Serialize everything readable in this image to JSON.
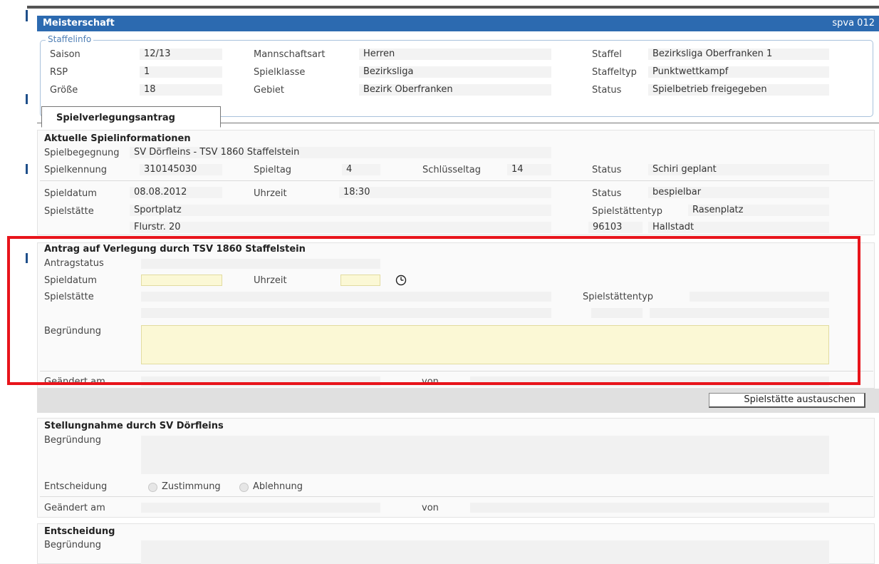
{
  "header": {
    "title": "Meisterschaft",
    "code": "spva 012"
  },
  "staffelinfo": {
    "legend": "Staffelinfo",
    "saison_label": "Saison",
    "saison": "12/13",
    "rsp_label": "RSP",
    "rsp": "1",
    "groesse_label": "Größe",
    "groesse": "18",
    "mannschaftsart_label": "Mannschaftsart",
    "mannschaftsart": "Herren",
    "spielklasse_label": "Spielklasse",
    "spielklasse": "Bezirksliga",
    "gebiet_label": "Gebiet",
    "gebiet": "Bezirk Oberfranken",
    "staffel_label": "Staffel",
    "staffel": "Bezirksliga Oberfranken 1",
    "staffeltyp_label": "Staffeltyp",
    "staffeltyp": "Punktwettkampf",
    "status_label": "Status",
    "status": "Spielbetrieb freigegeben"
  },
  "tab": {
    "label": "Spielverlegungsantrag"
  },
  "aktuell": {
    "title": "Aktuelle Spielinformationen",
    "spielbegegnung_label": "Spielbegegnung",
    "spielbegegnung": "SV Dörfleins - TSV 1860 Staffelstein",
    "spielkennung_label": "Spielkennung",
    "spielkennung": "310145030",
    "spieltag_label": "Spieltag",
    "spieltag": "4",
    "schluesseltag_label": "Schlüsseltag",
    "schluesseltag": "14",
    "status_label": "Status",
    "status": "Schiri geplant",
    "spieldatum_label": "Spieldatum",
    "spieldatum": "08.08.2012",
    "uhrzeit_label": "Uhrzeit",
    "uhrzeit": "18:30",
    "status2_label": "Status",
    "status2": "bespielbar",
    "spielstaette_label": "Spielstätte",
    "spielstaette": "Sportplatz",
    "spielstaettentyp_label": "Spielstättentyp",
    "spielstaettentyp": "Rasenplatz",
    "strasse": "Flurstr. 20",
    "plz": "96103",
    "ort": "Hallstadt"
  },
  "antrag": {
    "title": "Antrag auf Verlegung durch TSV 1860 Staffelstein",
    "antragstatus_label": "Antragstatus",
    "spieldatum_label": "Spieldatum",
    "uhrzeit_label": "Uhrzeit",
    "spielstaette_label": "Spielstätte",
    "spielstaettentyp_label": "Spielstättentyp",
    "begruendung_label": "Begründung",
    "geaendert_label": "Geändert am",
    "von_label": "von"
  },
  "button": {
    "spielstaette_austauschen": "Spielstätte austauschen"
  },
  "stellungnahme": {
    "title": "Stellungnahme durch SV Dörfleins",
    "begruendung_label": "Begründung",
    "entscheidung_label": "Entscheidung",
    "zustimmung": "Zustimmung",
    "ablehnung": "Ablehnung",
    "geaendert_label": "Geändert am",
    "von_label": "von"
  },
  "entscheidung": {
    "title": "Entscheidung",
    "begruendung_label": "Begründung"
  },
  "colors": {
    "accent": "#2c6ab0",
    "highlight": "#e8141b",
    "input_yellow": "#fbf8d5"
  }
}
